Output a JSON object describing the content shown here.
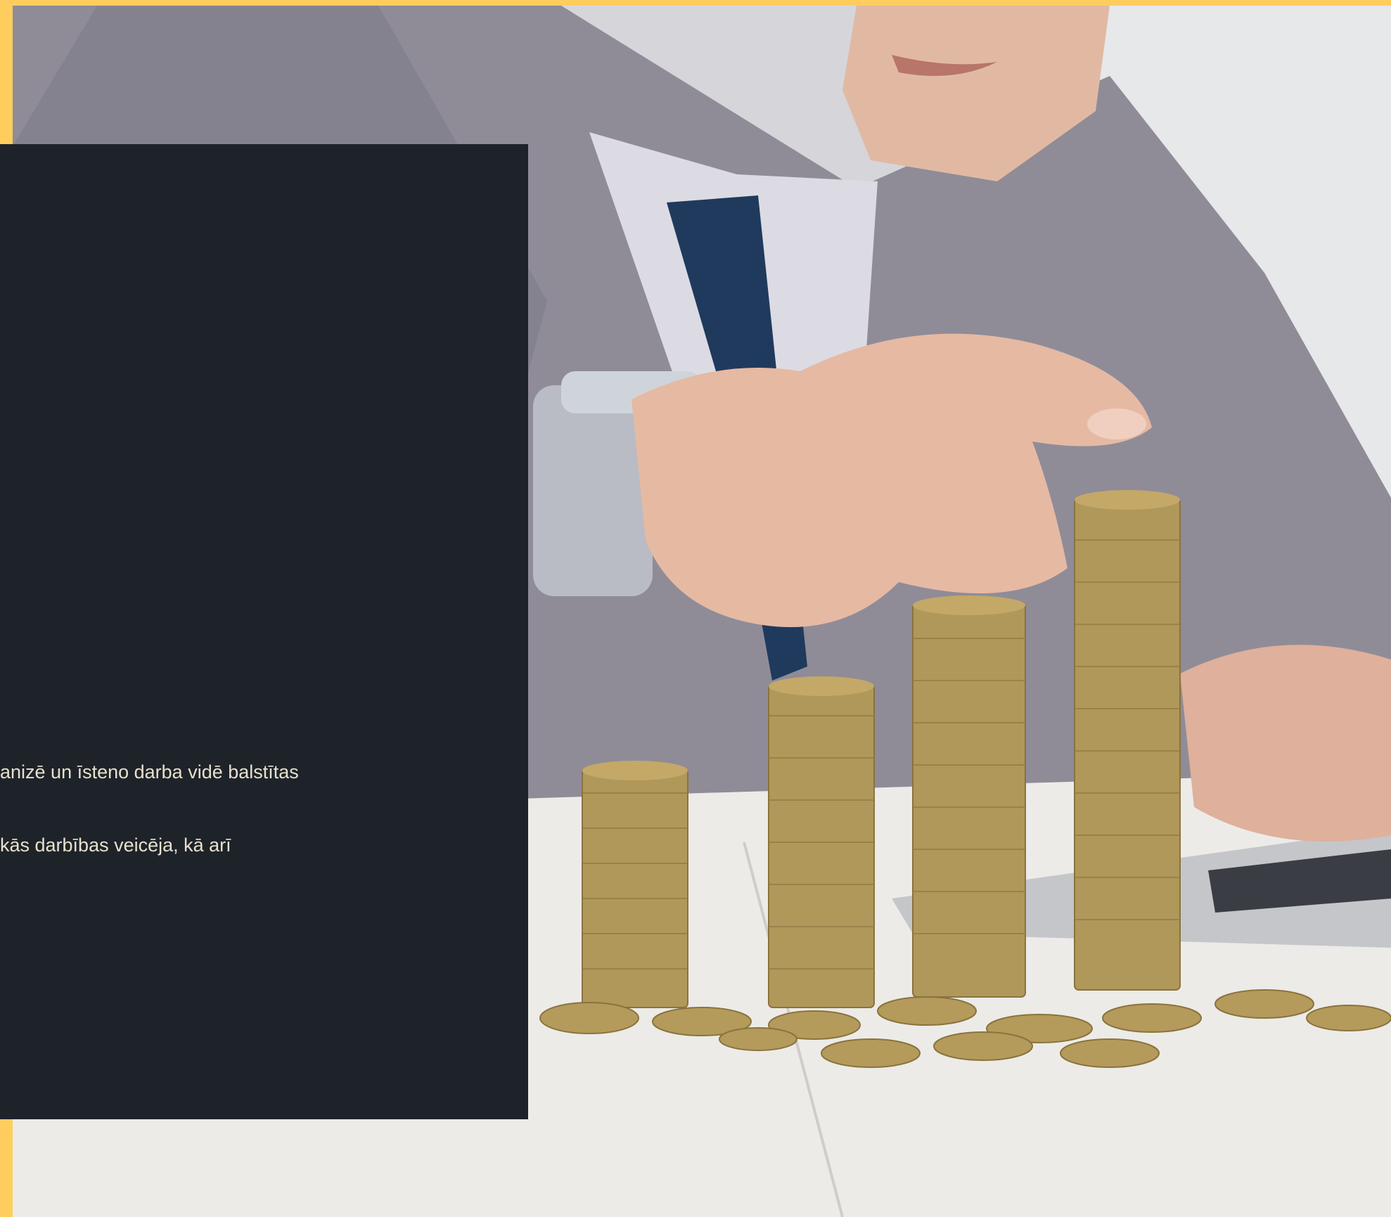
{
  "hero": {
    "image_alt": "Businessman stacking gold coins on desk",
    "text_lines": [
      "anizē un īsteno darba vidē balstītas",
      "kās darbības veicēja, kā arī"
    ]
  },
  "colors": {
    "accent_frame": "#ffcd5e",
    "panel_background": "#1e232a",
    "panel_text": "#e8e0cc"
  }
}
